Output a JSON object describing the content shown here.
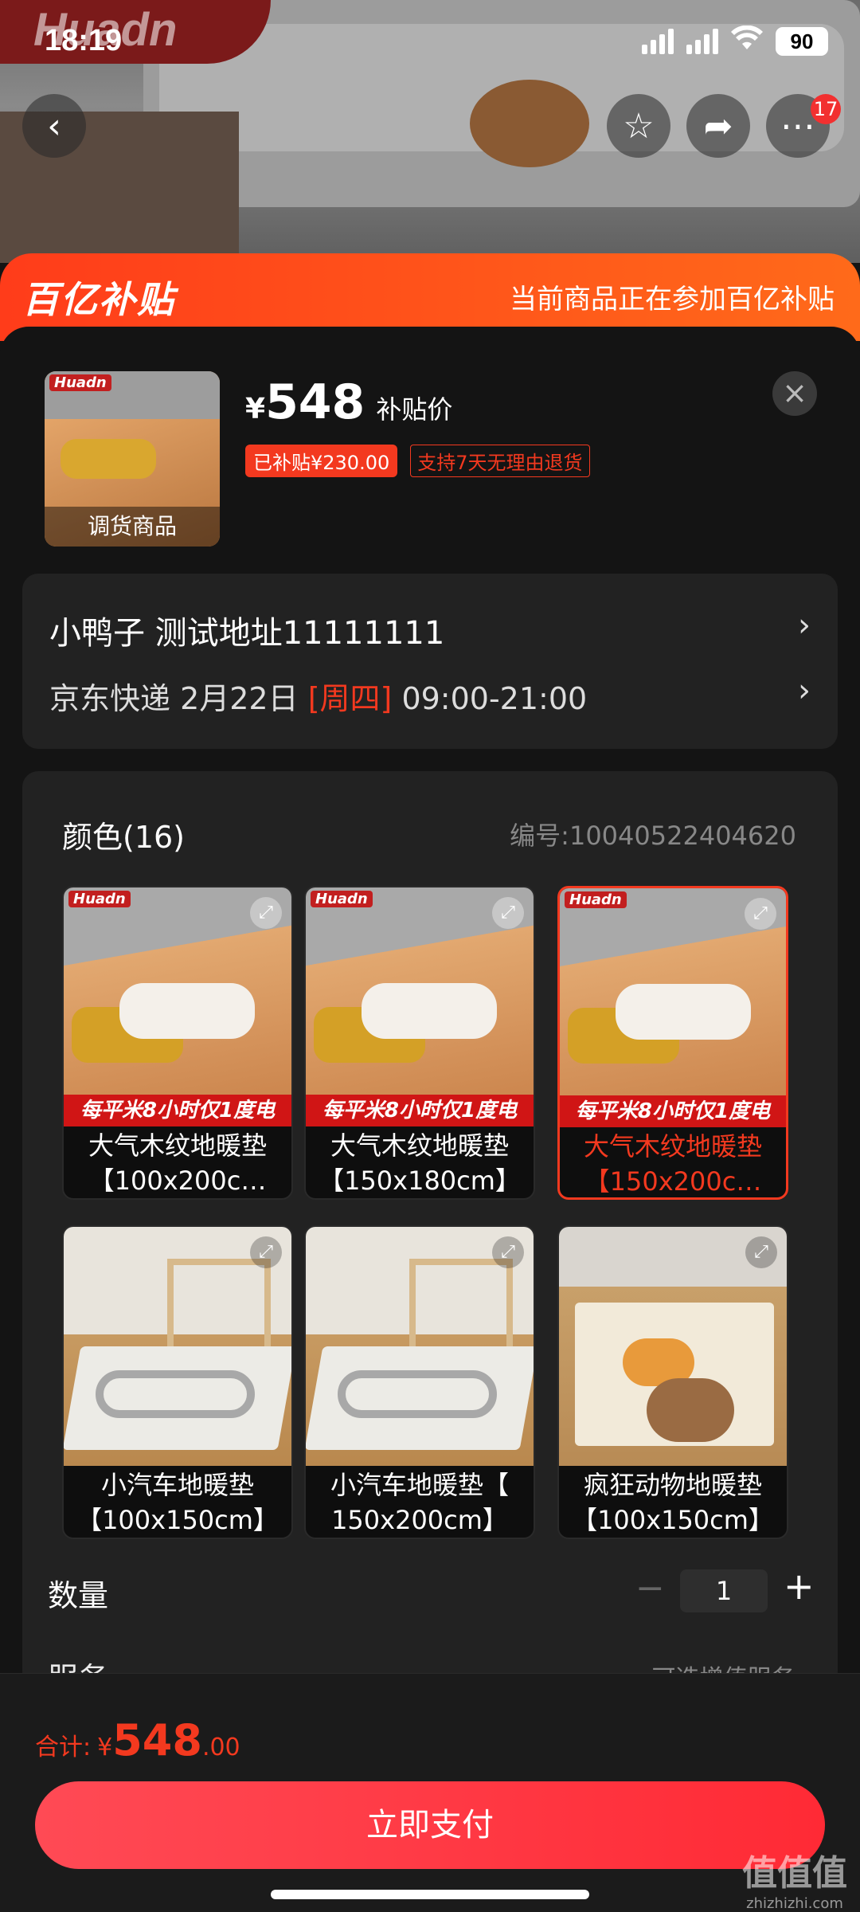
{
  "status_bar": {
    "time": "18:19",
    "battery": "90"
  },
  "header": {
    "brand_watermark": "Huadn",
    "notification_count": "17",
    "icons": [
      "back-icon",
      "star-icon",
      "share-icon",
      "more-icon"
    ]
  },
  "banner": {
    "logo": "百亿补贴",
    "message": "当前商品正在参加百亿补贴"
  },
  "product": {
    "thumb_label": "调货商品",
    "thumb_brand": "Huadn",
    "price_symbol": "¥",
    "price": "548",
    "price_tag": "补贴价",
    "subsidy_chip": "已补贴¥230.00",
    "return_chip": "支持7天无理由退货"
  },
  "address": {
    "line": "小鸭子  测试地址11111111",
    "ship_prefix": "京东快递 2月22日 ",
    "ship_weekday": "[周四]",
    "ship_time": " 09:00-21:00"
  },
  "variants": {
    "title": "颜色(16)",
    "sku": "编号:10040522404620",
    "promo_text": "每平米8小时仅1度电",
    "items": [
      {
        "line1": "大气木纹地暖垫",
        "line2": "【100x200c…",
        "selected": false
      },
      {
        "line1": "大气木纹地暖垫",
        "line2": "【150x180cm】",
        "selected": false
      },
      {
        "line1": "大气木纹地暖垫",
        "line2": "【150x200c…",
        "selected": true
      },
      {
        "line1": "小汽车地暖垫",
        "line2": "【100x150cm】",
        "selected": false
      },
      {
        "line1": "小汽车地暖垫【",
        "line2": "150x200cm】",
        "selected": false
      },
      {
        "line1": "疯狂动物地暖垫",
        "line2": "【100x150cm】",
        "selected": false
      }
    ]
  },
  "quantity": {
    "label": "数量",
    "value": "1",
    "minus": "−",
    "plus": "+"
  },
  "service": {
    "label": "服务",
    "option": "可选增值服务 ›"
  },
  "footer": {
    "total_label": "合计:",
    "total_symbol": "¥",
    "total_int": "548",
    "total_dec": ".00",
    "pay_button": "立即支付"
  },
  "watermark": {
    "cn": "值值值",
    "en": "zhizhizhi.com"
  },
  "colors": {
    "accent": "#f3391f",
    "pay": "#ff2a35",
    "background": "#141414",
    "card": "#222222"
  }
}
